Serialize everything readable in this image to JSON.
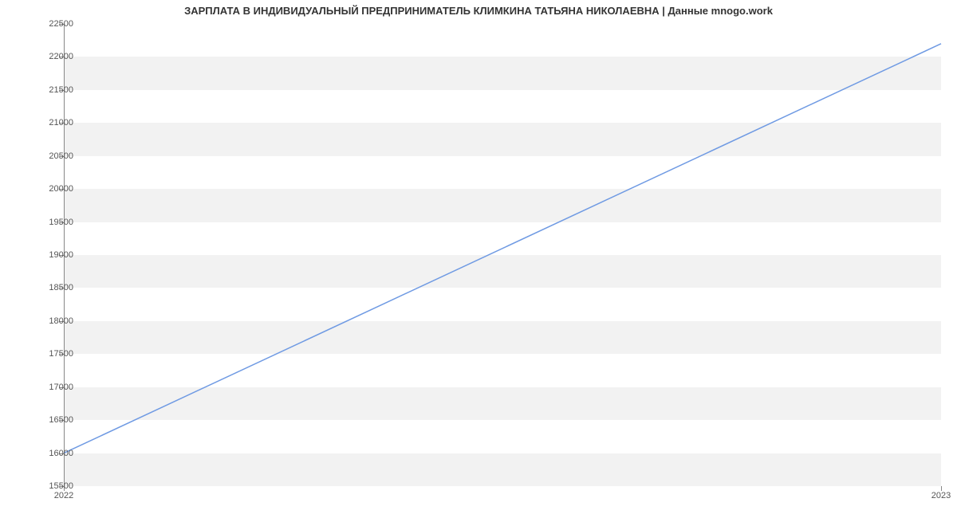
{
  "chart_data": {
    "type": "line",
    "title": "ЗАРПЛАТА В ИНДИВИДУАЛЬНЫЙ ПРЕДПРИНИМАТЕЛЬ КЛИМКИНА ТАТЬЯНА НИКОЛАЕВНА | Данные mnogo.work",
    "x": [
      2022,
      2023
    ],
    "values": [
      16000,
      22200
    ],
    "x_ticks": [
      2022,
      2023
    ],
    "y_ticks": [
      15500,
      16000,
      16500,
      17000,
      17500,
      18000,
      18500,
      19000,
      19500,
      20000,
      20500,
      21000,
      21500,
      22000,
      22500
    ],
    "xlabel": "",
    "ylabel": "",
    "ylim": [
      15500,
      22500
    ],
    "xlim": [
      2022,
      2023
    ],
    "series_color": "#6f9ae3",
    "grid": "banded"
  }
}
